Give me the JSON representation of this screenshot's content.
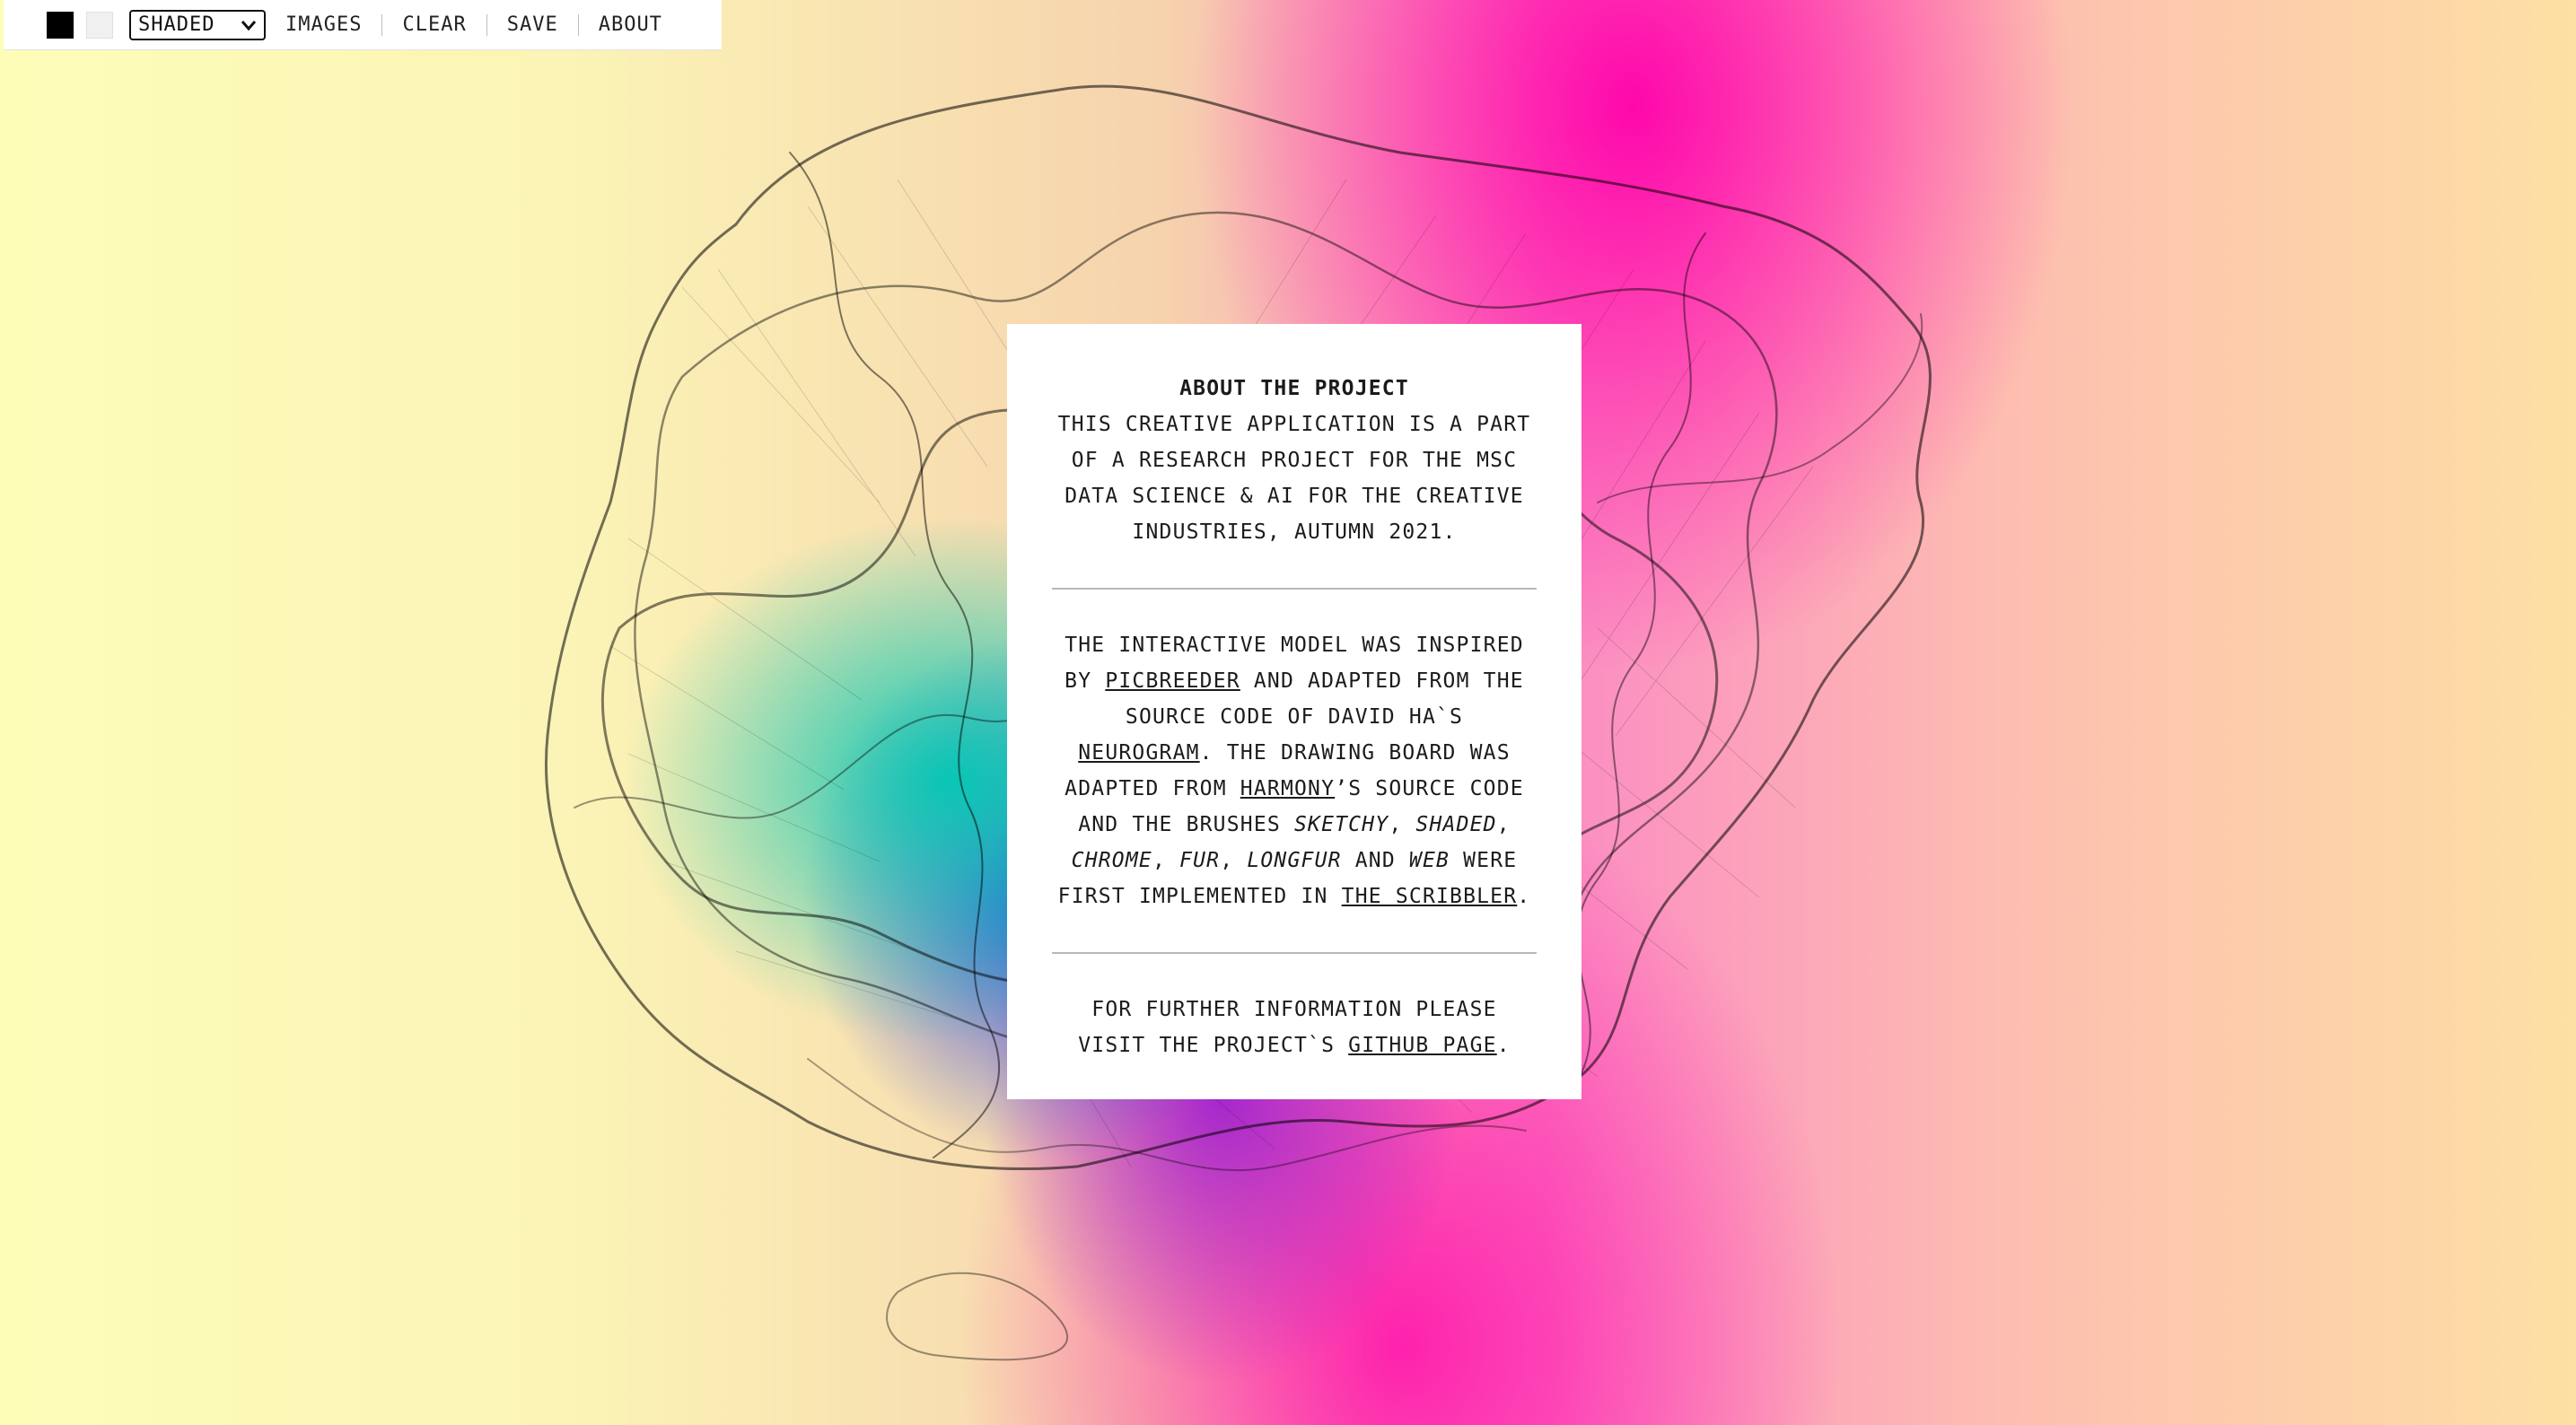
{
  "colors": {
    "foreground_swatch": "#000000",
    "background_swatch": "#f0f0f0"
  },
  "toolbar": {
    "brush_selected": "SHADED",
    "images_label": "IMAGES",
    "clear_label": "CLEAR",
    "save_label": "SAVE",
    "about_label": "ABOUT"
  },
  "about": {
    "title": "ABOUT THE PROJECT",
    "intro": "THIS CREATIVE APPLICATION IS A PART OF A RESEARCH PROJECT FOR THE MSC DATA SCIENCE & AI FOR THE CREATIVE INDUSTRIES, AUTUMN 2021.",
    "p2": {
      "t1": "THE INTERACTIVE MODEL WAS INSPIRED BY ",
      "link_picbreeder": "PICBREEDER",
      "t2": " AND ADAPTED FROM THE SOURCE CODE OF DAVID HA`S ",
      "link_neurogram": "NEUROGRAM",
      "t3": ". THE DRAWING BOARD WAS ADAPTED FROM ",
      "link_harmony": "HARMONY",
      "t4": "’S SOURCE CODE AND THE BRUSHES ",
      "brush_sketchy": "SKETCHY",
      "c1": ", ",
      "brush_shaded": "SHADED",
      "c2": ", ",
      "brush_chrome": "CHROME",
      "c3": ", ",
      "brush_fur": "FUR",
      "c4": ", ",
      "brush_longfur": "LONGFUR",
      "t5": " AND ",
      "brush_web": "WEB",
      "t6": " WERE FIRST IMPLEMENTED IN ",
      "link_scribbler": "THE SCRIBBLER",
      "t7": "."
    },
    "p3": {
      "t1": "FOR FURTHER INFORMATION PLEASE VISIT THE PROJECT`S ",
      "link_github": "GITHUB PAGE",
      "t2": "."
    }
  }
}
